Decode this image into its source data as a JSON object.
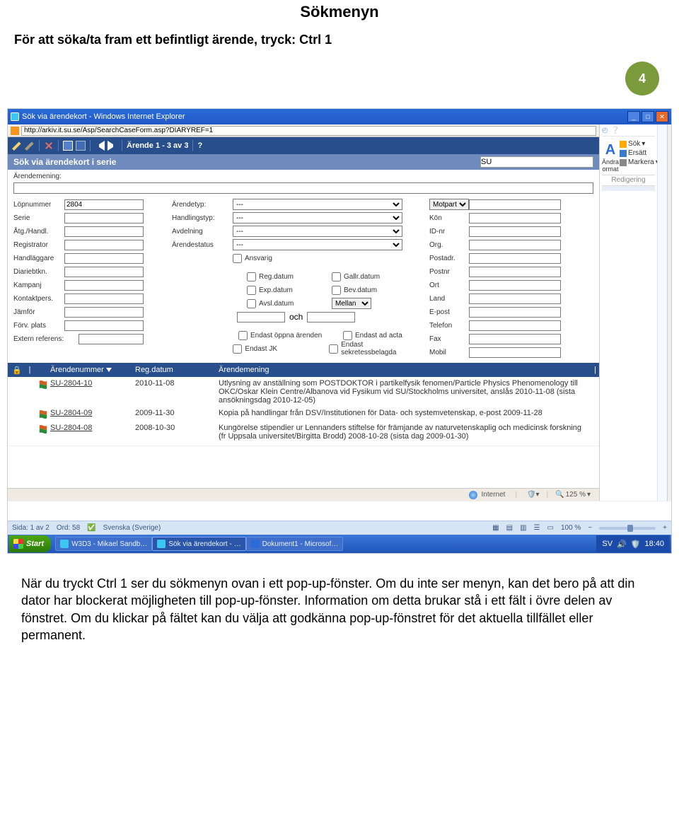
{
  "doc": {
    "heading": "Sökmenyn",
    "intro_prefix": "För att söka/ta fram ett befintligt ärende, tryck:  ",
    "intro_shortcut": "Ctrl  1",
    "page_number": "4",
    "para": "När du tryckt  Ctrl  1  ser du sökmenyn ovan i ett pop-up-fönster. Om du inte ser menyn, kan det bero på att din dator har blockerat möjligheten till pop-up-fönster. Information om detta brukar stå i ett fält i övre delen av fönstret. Om du klickar på fältet kan du välja att godkänna pop-up-fönstret för det aktuella tillfället eller permanent."
  },
  "ie": {
    "title": "Sök via ärendekort - Windows Internet Explorer",
    "url": "http://arkiv.it.su.se/Asp/SearchCaseForm.asp?DIARYREF=1",
    "status_zone": "Internet",
    "status_zoom": "125 %"
  },
  "ribbon": {
    "sok": "Sök",
    "ersatt": "Ersätt",
    "andra": "Ändra",
    "format": "ormat",
    "markera": "Markera",
    "group": "Redigering"
  },
  "toolbar": {
    "arende_counter": "Ärende 1 - 3 av 3",
    "subtitle": "Sök via ärendekort i serie",
    "subtitle_value": "SU"
  },
  "form": {
    "arendemening_label": "Ärendemening:",
    "col1": {
      "lopnummer": "Löpnummer",
      "lopnummer_val": "2804",
      "serie": "Serie",
      "atg": "Åtg./Handl.",
      "registrator": "Registrator",
      "handlaggare": "Handläggare",
      "diariebtkn": "Diariebtkn.",
      "kampanj": "Kampanj",
      "kontaktpers": "Kontaktpers.",
      "jamfor": "Jämför",
      "forvplats": "Förv. plats",
      "extern": "Extern referens:"
    },
    "col2": {
      "arendetyp": "Ärendetyp:",
      "handlingstyp": "Handlingstyp:",
      "avdelning": "Avdelning",
      "arendestatus": "Ärendestatus",
      "blank_sel": "---",
      "ansvarig": "Ansvarig",
      "regdatum": "Reg.datum",
      "gallrdatum": "Gallr.datum",
      "expdatum": "Exp.datum",
      "bevdatum": "Bev.datum",
      "avsldatum": "Avsl.datum",
      "mellan": "Mellan",
      "och": "och",
      "endast_oppna": "Endast öppna ärenden",
      "endast_ad": "Endast ad acta",
      "endast_jk": "Endast JK",
      "endast_sekr": "Endast sekretessbelagda"
    },
    "col3": {
      "motpart": "Motpart",
      "kon": "Kön",
      "idnr": "ID-nr",
      "org": "Org.",
      "postadr": "Postadr.",
      "postnr": "Postnr",
      "ort": "Ort",
      "land": "Land",
      "epost": "E-post",
      "telefon": "Telefon",
      "fax": "Fax",
      "mobil": "Mobil"
    }
  },
  "results": {
    "headers": {
      "arendenummer": "Ärendenummer",
      "regdatum": "Reg.datum",
      "arendemening": "Ärendemening"
    },
    "rows": [
      {
        "nr": "SU-2804-10",
        "date": "2010-11-08",
        "text": "Utlysning av anställning som POSTDOKTOR i partikelfysik fenomen/Particle Physics Phenomenology till OKC/Oskar Klein Centre/Albanova vid Fysikum vid SU/Stockholms universitet, anslås 2010-11-08 (sista ansökningsdag 2010-12-05)"
      },
      {
        "nr": "SU-2804-09",
        "date": "2009-11-30",
        "text": "Kopia på handlingar från DSV/Institutionen för Data- och systemvetenskap, e-post 2009-11-28"
      },
      {
        "nr": "SU-2804-08",
        "date": "2008-10-30",
        "text": "Kungörelse stipendier ur Lennanders stiftelse för främjande av naturvetenskaplig och medicinsk forskning (fr Uppsala universitet/Birgitta Brodd) 2008-10-28 (sista dag 2009-01-30)"
      }
    ]
  },
  "wordstatus": {
    "sida": "Sida: 1 av 2",
    "ord": "Ord: 58",
    "lang": "Svenska (Sverige)",
    "zoom": "100 %"
  },
  "taskbar": {
    "start": "Start",
    "btn1": "W3D3 - Mikael Sandb…",
    "btn2": "Sök via ärendekort - …",
    "btn3": "Dokument1 - Microsof…",
    "lang": "SV",
    "clock": "18:40"
  }
}
